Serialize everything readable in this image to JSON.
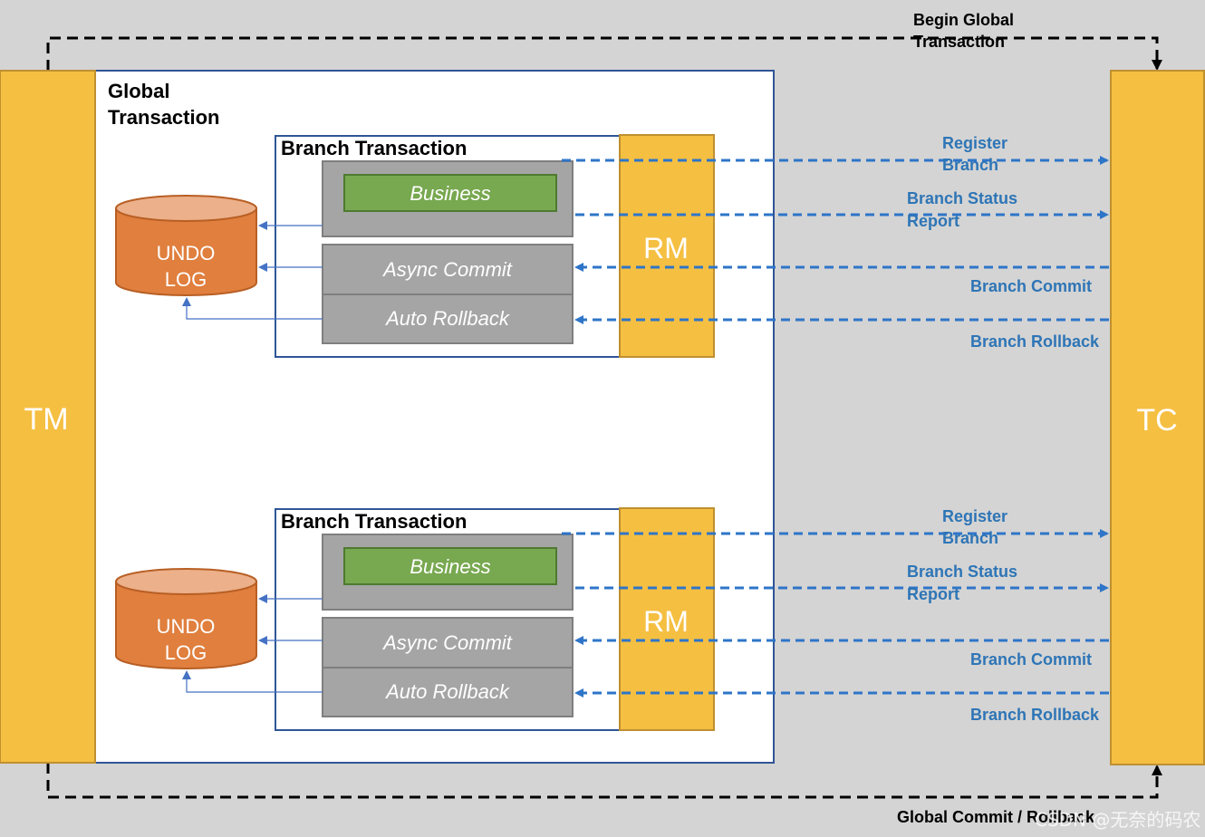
{
  "colors": {
    "background": "#d4d4d4",
    "tm_tc": "#f5bf42",
    "rm": "#f5bf42",
    "undo_log": "#e07f3e",
    "undo_log_top": "#ecb08a",
    "business": "#78a850",
    "step_box": "#a5a5a5",
    "message": "#2e75c8",
    "global_flow": "#000000"
  },
  "tm": {
    "label": "TM"
  },
  "tc": {
    "label": "TC"
  },
  "global_transaction": {
    "line1": "Global",
    "line2": "Transaction"
  },
  "begin_global": {
    "line1": "Begin Global",
    "line2": "Transaction"
  },
  "global_commit": {
    "label": "Global Commit / Rollback"
  },
  "watermark": "CSDN @无奈的码农",
  "branches": [
    {
      "title": "Branch Transaction",
      "business": "Business",
      "async_commit": "Async Commit",
      "auto_rollback": "Auto Rollback",
      "undo_line1": "UNDO",
      "undo_line2": "LOG",
      "rm": "RM",
      "messages": {
        "register_1": "Register",
        "register_2": "Branch",
        "status_1": "Branch Status",
        "status_2": "Report",
        "commit": "Branch Commit",
        "rollback": "Branch Rollback"
      }
    },
    {
      "title": "Branch Transaction",
      "business": "Business",
      "async_commit": "Async Commit",
      "auto_rollback": "Auto Rollback",
      "undo_line1": "UNDO",
      "undo_line2": "LOG",
      "rm": "RM",
      "messages": {
        "register_1": "Register",
        "register_2": "Branch",
        "status_1": "Branch Status",
        "status_2": "Report",
        "commit": "Branch Commit",
        "rollback": "Branch Rollback"
      }
    }
  ]
}
